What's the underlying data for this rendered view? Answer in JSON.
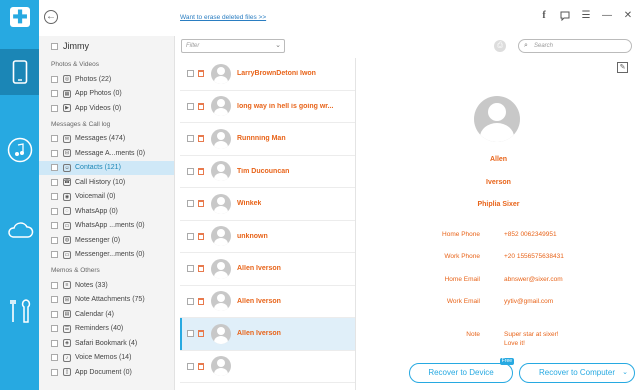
{
  "rail": {
    "logo": "✚",
    "items": [
      "phone-icon",
      "music-icon",
      "cloud-icon",
      "tools-icon"
    ]
  },
  "topbar": {
    "erase_link": "Want to erase deleted files >>",
    "icons": [
      "facebook-icon",
      "chat-icon",
      "menu-icon",
      "minimize-icon",
      "close-icon"
    ]
  },
  "sidebar": {
    "device": "Jimmy",
    "groups": [
      {
        "title": "Photos & Videos",
        "items": [
          {
            "label": "Photos (22)",
            "icon": "photo-icon"
          },
          {
            "label": "App Photos (0)",
            "icon": "app-photo-icon"
          },
          {
            "label": "App Videos (0)",
            "icon": "video-icon"
          }
        ]
      },
      {
        "title": "Messages & Call log",
        "items": [
          {
            "label": "Messages (474)",
            "icon": "message-icon"
          },
          {
            "label": "Message A...ments (0)",
            "icon": "attachment-icon"
          },
          {
            "label": "Contacts (121)",
            "icon": "contact-icon",
            "selected": true
          },
          {
            "label": "Call History (10)",
            "icon": "phone-call-icon"
          },
          {
            "label": "Voicemail (0)",
            "icon": "voicemail-icon"
          },
          {
            "label": "WhatsApp (0)",
            "icon": "whatsapp-icon"
          },
          {
            "label": "WhatsApp ...ments (0)",
            "icon": "whatsapp-attachment-icon"
          },
          {
            "label": "Messenger (0)",
            "icon": "messenger-icon"
          },
          {
            "label": "Messenger...ments (0)",
            "icon": "messenger-attachment-icon"
          }
        ]
      },
      {
        "title": "Memos & Others",
        "items": [
          {
            "label": "Notes (33)",
            "icon": "notes-icon"
          },
          {
            "label": "Note Attachments (75)",
            "icon": "note-attachment-icon"
          },
          {
            "label": "Calendar (4)",
            "icon": "calendar-icon"
          },
          {
            "label": "Reminders (40)",
            "icon": "reminder-icon"
          },
          {
            "label": "Safari Bookmark (4)",
            "icon": "bookmark-icon"
          },
          {
            "label": "Voice Memos (14)",
            "icon": "voice-memo-icon"
          },
          {
            "label": "App Document (0)",
            "icon": "document-icon"
          }
        ]
      }
    ]
  },
  "filter": {
    "placeholder": "Filter"
  },
  "search": {
    "placeholder": "Search"
  },
  "contacts": [
    {
      "name": "LarryBrownDetoni Iwon"
    },
    {
      "name": "long way in hell is going wr..."
    },
    {
      "name": "Runnning Man"
    },
    {
      "name": "Tim  Ducouncan"
    },
    {
      "name": "Winkek"
    },
    {
      "name": "unknown"
    },
    {
      "name": "Allen  Iverson"
    },
    {
      "name": "Allen  Iverson"
    },
    {
      "name": "Allen  Iverson",
      "selected": true
    },
    {
      "name": ""
    }
  ],
  "detail": {
    "first": "Allen",
    "last": "Iverson",
    "company": "Phiplia Sixer",
    "fields": [
      {
        "label": "Home Phone",
        "value": "+852 0062349951"
      },
      {
        "label": "Work Phone",
        "value": "+20 1556575638431"
      },
      {
        "label": "Home Email",
        "value": "abnswer@sixer.com"
      },
      {
        "label": "Work Email",
        "value": "yytiv@gmail.com"
      },
      {
        "label": "Note",
        "value": "Super star at sixer!\nLove it!\nAdmire it!"
      }
    ]
  },
  "buttons": {
    "recover_device": "Recover to Device",
    "free_badge": "Free",
    "recover_computer": "Recover to Computer"
  },
  "colors": {
    "accent": "#27a9e1",
    "name_orange": "#e8641a"
  }
}
